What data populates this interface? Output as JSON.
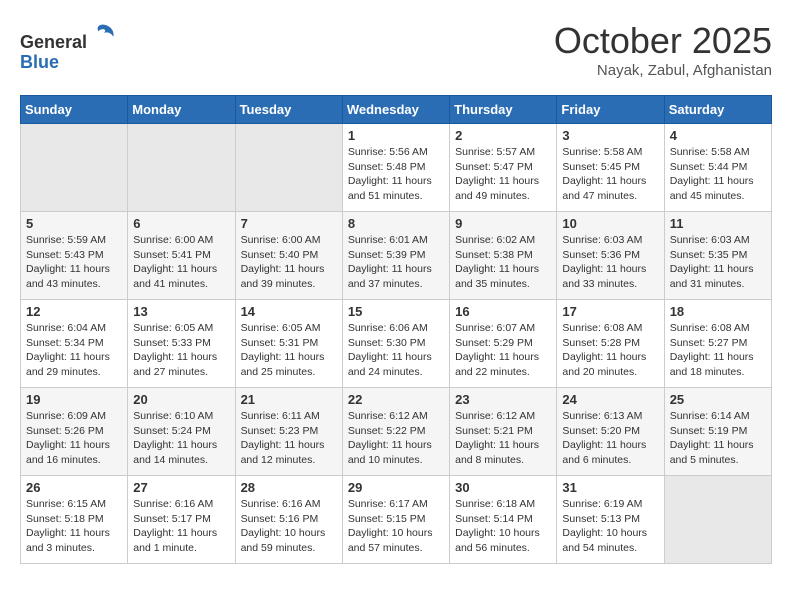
{
  "header": {
    "logo_line1": "General",
    "logo_line2": "Blue",
    "month_title": "October 2025",
    "location": "Nayak, Zabul, Afghanistan"
  },
  "weekdays": [
    "Sunday",
    "Monday",
    "Tuesday",
    "Wednesday",
    "Thursday",
    "Friday",
    "Saturday"
  ],
  "weeks": [
    [
      {
        "day": null
      },
      {
        "day": null
      },
      {
        "day": null
      },
      {
        "day": 1,
        "sunrise": "5:56 AM",
        "sunset": "5:48 PM",
        "daylight": "11 hours and 51 minutes."
      },
      {
        "day": 2,
        "sunrise": "5:57 AM",
        "sunset": "5:47 PM",
        "daylight": "11 hours and 49 minutes."
      },
      {
        "day": 3,
        "sunrise": "5:58 AM",
        "sunset": "5:45 PM",
        "daylight": "11 hours and 47 minutes."
      },
      {
        "day": 4,
        "sunrise": "5:58 AM",
        "sunset": "5:44 PM",
        "daylight": "11 hours and 45 minutes."
      }
    ],
    [
      {
        "day": 5,
        "sunrise": "5:59 AM",
        "sunset": "5:43 PM",
        "daylight": "11 hours and 43 minutes."
      },
      {
        "day": 6,
        "sunrise": "6:00 AM",
        "sunset": "5:41 PM",
        "daylight": "11 hours and 41 minutes."
      },
      {
        "day": 7,
        "sunrise": "6:00 AM",
        "sunset": "5:40 PM",
        "daylight": "11 hours and 39 minutes."
      },
      {
        "day": 8,
        "sunrise": "6:01 AM",
        "sunset": "5:39 PM",
        "daylight": "11 hours and 37 minutes."
      },
      {
        "day": 9,
        "sunrise": "6:02 AM",
        "sunset": "5:38 PM",
        "daylight": "11 hours and 35 minutes."
      },
      {
        "day": 10,
        "sunrise": "6:03 AM",
        "sunset": "5:36 PM",
        "daylight": "11 hours and 33 minutes."
      },
      {
        "day": 11,
        "sunrise": "6:03 AM",
        "sunset": "5:35 PM",
        "daylight": "11 hours and 31 minutes."
      }
    ],
    [
      {
        "day": 12,
        "sunrise": "6:04 AM",
        "sunset": "5:34 PM",
        "daylight": "11 hours and 29 minutes."
      },
      {
        "day": 13,
        "sunrise": "6:05 AM",
        "sunset": "5:33 PM",
        "daylight": "11 hours and 27 minutes."
      },
      {
        "day": 14,
        "sunrise": "6:05 AM",
        "sunset": "5:31 PM",
        "daylight": "11 hours and 25 minutes."
      },
      {
        "day": 15,
        "sunrise": "6:06 AM",
        "sunset": "5:30 PM",
        "daylight": "11 hours and 24 minutes."
      },
      {
        "day": 16,
        "sunrise": "6:07 AM",
        "sunset": "5:29 PM",
        "daylight": "11 hours and 22 minutes."
      },
      {
        "day": 17,
        "sunrise": "6:08 AM",
        "sunset": "5:28 PM",
        "daylight": "11 hours and 20 minutes."
      },
      {
        "day": 18,
        "sunrise": "6:08 AM",
        "sunset": "5:27 PM",
        "daylight": "11 hours and 18 minutes."
      }
    ],
    [
      {
        "day": 19,
        "sunrise": "6:09 AM",
        "sunset": "5:26 PM",
        "daylight": "11 hours and 16 minutes."
      },
      {
        "day": 20,
        "sunrise": "6:10 AM",
        "sunset": "5:24 PM",
        "daylight": "11 hours and 14 minutes."
      },
      {
        "day": 21,
        "sunrise": "6:11 AM",
        "sunset": "5:23 PM",
        "daylight": "11 hours and 12 minutes."
      },
      {
        "day": 22,
        "sunrise": "6:12 AM",
        "sunset": "5:22 PM",
        "daylight": "11 hours and 10 minutes."
      },
      {
        "day": 23,
        "sunrise": "6:12 AM",
        "sunset": "5:21 PM",
        "daylight": "11 hours and 8 minutes."
      },
      {
        "day": 24,
        "sunrise": "6:13 AM",
        "sunset": "5:20 PM",
        "daylight": "11 hours and 6 minutes."
      },
      {
        "day": 25,
        "sunrise": "6:14 AM",
        "sunset": "5:19 PM",
        "daylight": "11 hours and 5 minutes."
      }
    ],
    [
      {
        "day": 26,
        "sunrise": "6:15 AM",
        "sunset": "5:18 PM",
        "daylight": "11 hours and 3 minutes."
      },
      {
        "day": 27,
        "sunrise": "6:16 AM",
        "sunset": "5:17 PM",
        "daylight": "11 hours and 1 minute."
      },
      {
        "day": 28,
        "sunrise": "6:16 AM",
        "sunset": "5:16 PM",
        "daylight": "10 hours and 59 minutes."
      },
      {
        "day": 29,
        "sunrise": "6:17 AM",
        "sunset": "5:15 PM",
        "daylight": "10 hours and 57 minutes."
      },
      {
        "day": 30,
        "sunrise": "6:18 AM",
        "sunset": "5:14 PM",
        "daylight": "10 hours and 56 minutes."
      },
      {
        "day": 31,
        "sunrise": "6:19 AM",
        "sunset": "5:13 PM",
        "daylight": "10 hours and 54 minutes."
      },
      {
        "day": null
      }
    ]
  ]
}
